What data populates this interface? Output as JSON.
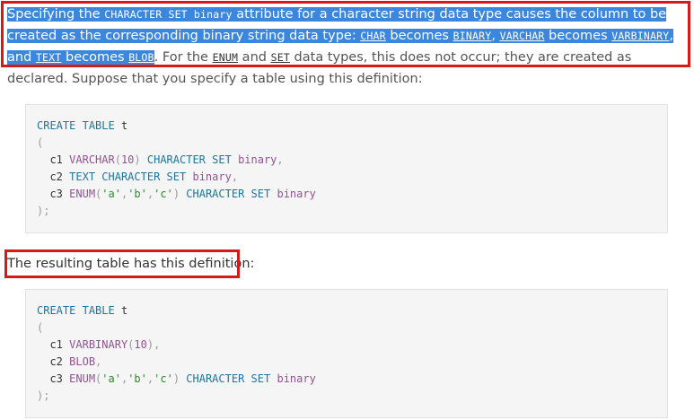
{
  "para": {
    "t1": "Specifying the ",
    "c1": "CHARACTER SET binary",
    "t2": " attribute for a character string data type causes the column to be created as the corresponding binary string data type: ",
    "c2": "CHAR",
    "t3": " becomes ",
    "c3": "BINARY",
    "t4": ", ",
    "c4": "VARCHAR",
    "t5": " becomes ",
    "c5": "VARBINARY",
    "t6": ", and ",
    "c6": "TEXT",
    "t7": " becomes ",
    "c7": "BLOB",
    "t8": ". For the ",
    "c8": "ENUM",
    "t9": " and ",
    "c9": "SET",
    "t10": " data types, this does not occur; they are created as declared. Suppose that you specify a table using this definition:"
  },
  "code1": {
    "l1": [
      "CREATE",
      "TABLE",
      "t"
    ],
    "l2": "(",
    "l3": [
      "c1",
      "VARCHAR",
      "(",
      "10",
      ")",
      "CHARACTER",
      "SET",
      "binary",
      ","
    ],
    "l4": [
      "c2",
      "TEXT",
      "CHARACTER",
      "SET",
      "binary",
      ","
    ],
    "l5": [
      "c3",
      "ENUM",
      "(",
      "'a'",
      ",",
      "'b'",
      ",",
      "'c'",
      ")",
      "CHARACTER",
      "SET",
      "binary"
    ],
    "l6": ");"
  },
  "line2": "The resulting table has this definition:",
  "code2": {
    "l1": [
      "CREATE",
      "TABLE",
      "t"
    ],
    "l2": "(",
    "l3": [
      "c1",
      "VARBINARY",
      "(",
      "10",
      ")",
      ","
    ],
    "l4": [
      "c2",
      "BLOB",
      ","
    ],
    "l5": [
      "c3",
      "ENUM",
      "(",
      "'a'",
      ",",
      "'b'",
      ",",
      "'c'",
      ")",
      "CHARACTER",
      "SET",
      "binary"
    ],
    "l6": ");"
  },
  "colors": {
    "highlight": "#3b87dd",
    "annotation_box": "#d51a1a",
    "code_background": "#f5f5f5",
    "keyword": "#21759b"
  }
}
